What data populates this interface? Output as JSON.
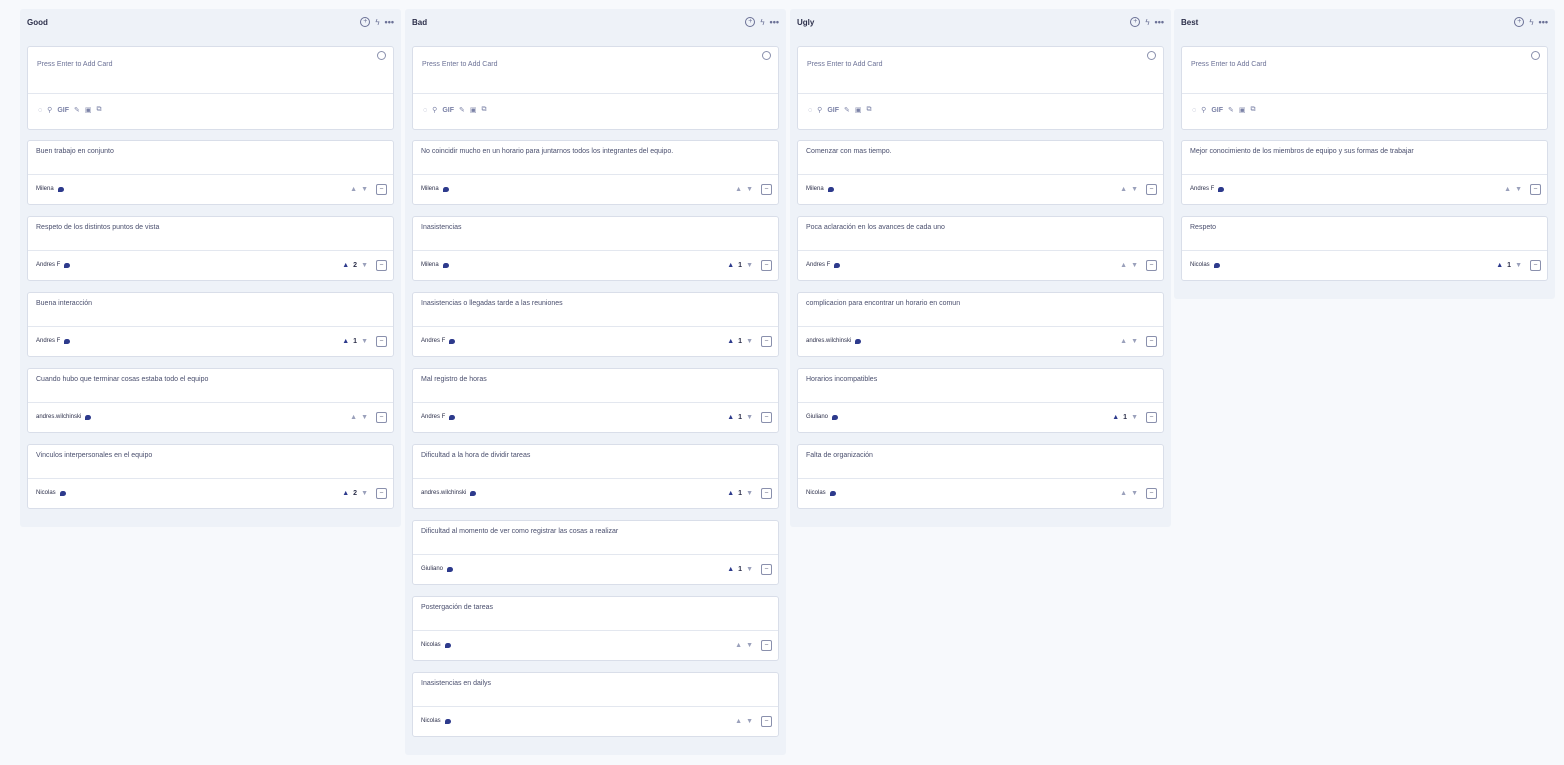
{
  "composer": {
    "placeholder": "Press Enter to Add Card",
    "gif_label": "GIF"
  },
  "columns": [
    {
      "title": "Good",
      "cards": [
        {
          "text": "Buen trabajo en conjunto",
          "author": "Milena",
          "votes": ""
        },
        {
          "text": "Respeto de los distintos puntos de vista",
          "author": "Andres F",
          "votes": "2"
        },
        {
          "text": "Buena interacción",
          "author": "Andres F",
          "votes": "1"
        },
        {
          "text": "Cuando hubo que terminar cosas estaba todo el equipo",
          "author": "andres.wilchinski",
          "votes": ""
        },
        {
          "text": "Vinculos interpersonales en el equipo",
          "author": "Nicolas",
          "votes": "2"
        }
      ]
    },
    {
      "title": "Bad",
      "cards": [
        {
          "text": "No coincidir mucho en un horario para juntarnos todos los integrantes del equipo.",
          "author": "Milena",
          "votes": ""
        },
        {
          "text": "Inasistencias",
          "author": "Milena",
          "votes": "1"
        },
        {
          "text": "Inasistencias o llegadas tarde a las reuniones",
          "author": "Andres F",
          "votes": "1"
        },
        {
          "text": "Mal registro de horas",
          "author": "Andres F",
          "votes": "1"
        },
        {
          "text": "Dificultad a la hora de dividir tareas",
          "author": "andres.wilchinski",
          "votes": "1"
        },
        {
          "text": "Dificultad al momento de ver como registrar las cosas a realizar",
          "author": "Giuliano",
          "votes": "1"
        },
        {
          "text": "Postergación de tareas",
          "author": "Nicolas",
          "votes": ""
        },
        {
          "text": "Inasistencias en dailys",
          "author": "Nicolas",
          "votes": ""
        }
      ]
    },
    {
      "title": "Ugly",
      "cards": [
        {
          "text": "Comenzar con mas tiempo.",
          "author": "Milena",
          "votes": ""
        },
        {
          "text": "Poca aclaración en los avances de cada uno",
          "author": "Andres F",
          "votes": ""
        },
        {
          "text": "complicacion para encontrar un horario en comun",
          "author": "andres.wilchinski",
          "votes": ""
        },
        {
          "text": "Horarios incompatibles",
          "author": "Giuliano",
          "votes": "1"
        },
        {
          "text": "Falta de organización",
          "author": "Nicolas",
          "votes": ""
        }
      ]
    },
    {
      "title": "Best",
      "cards": [
        {
          "text": "Mejor conocimiento de los miembros de equipo y sus formas de trabajar",
          "author": "Andres F",
          "votes": ""
        },
        {
          "text": "Respeto",
          "author": "Nicolas",
          "votes": "1"
        }
      ]
    }
  ]
}
